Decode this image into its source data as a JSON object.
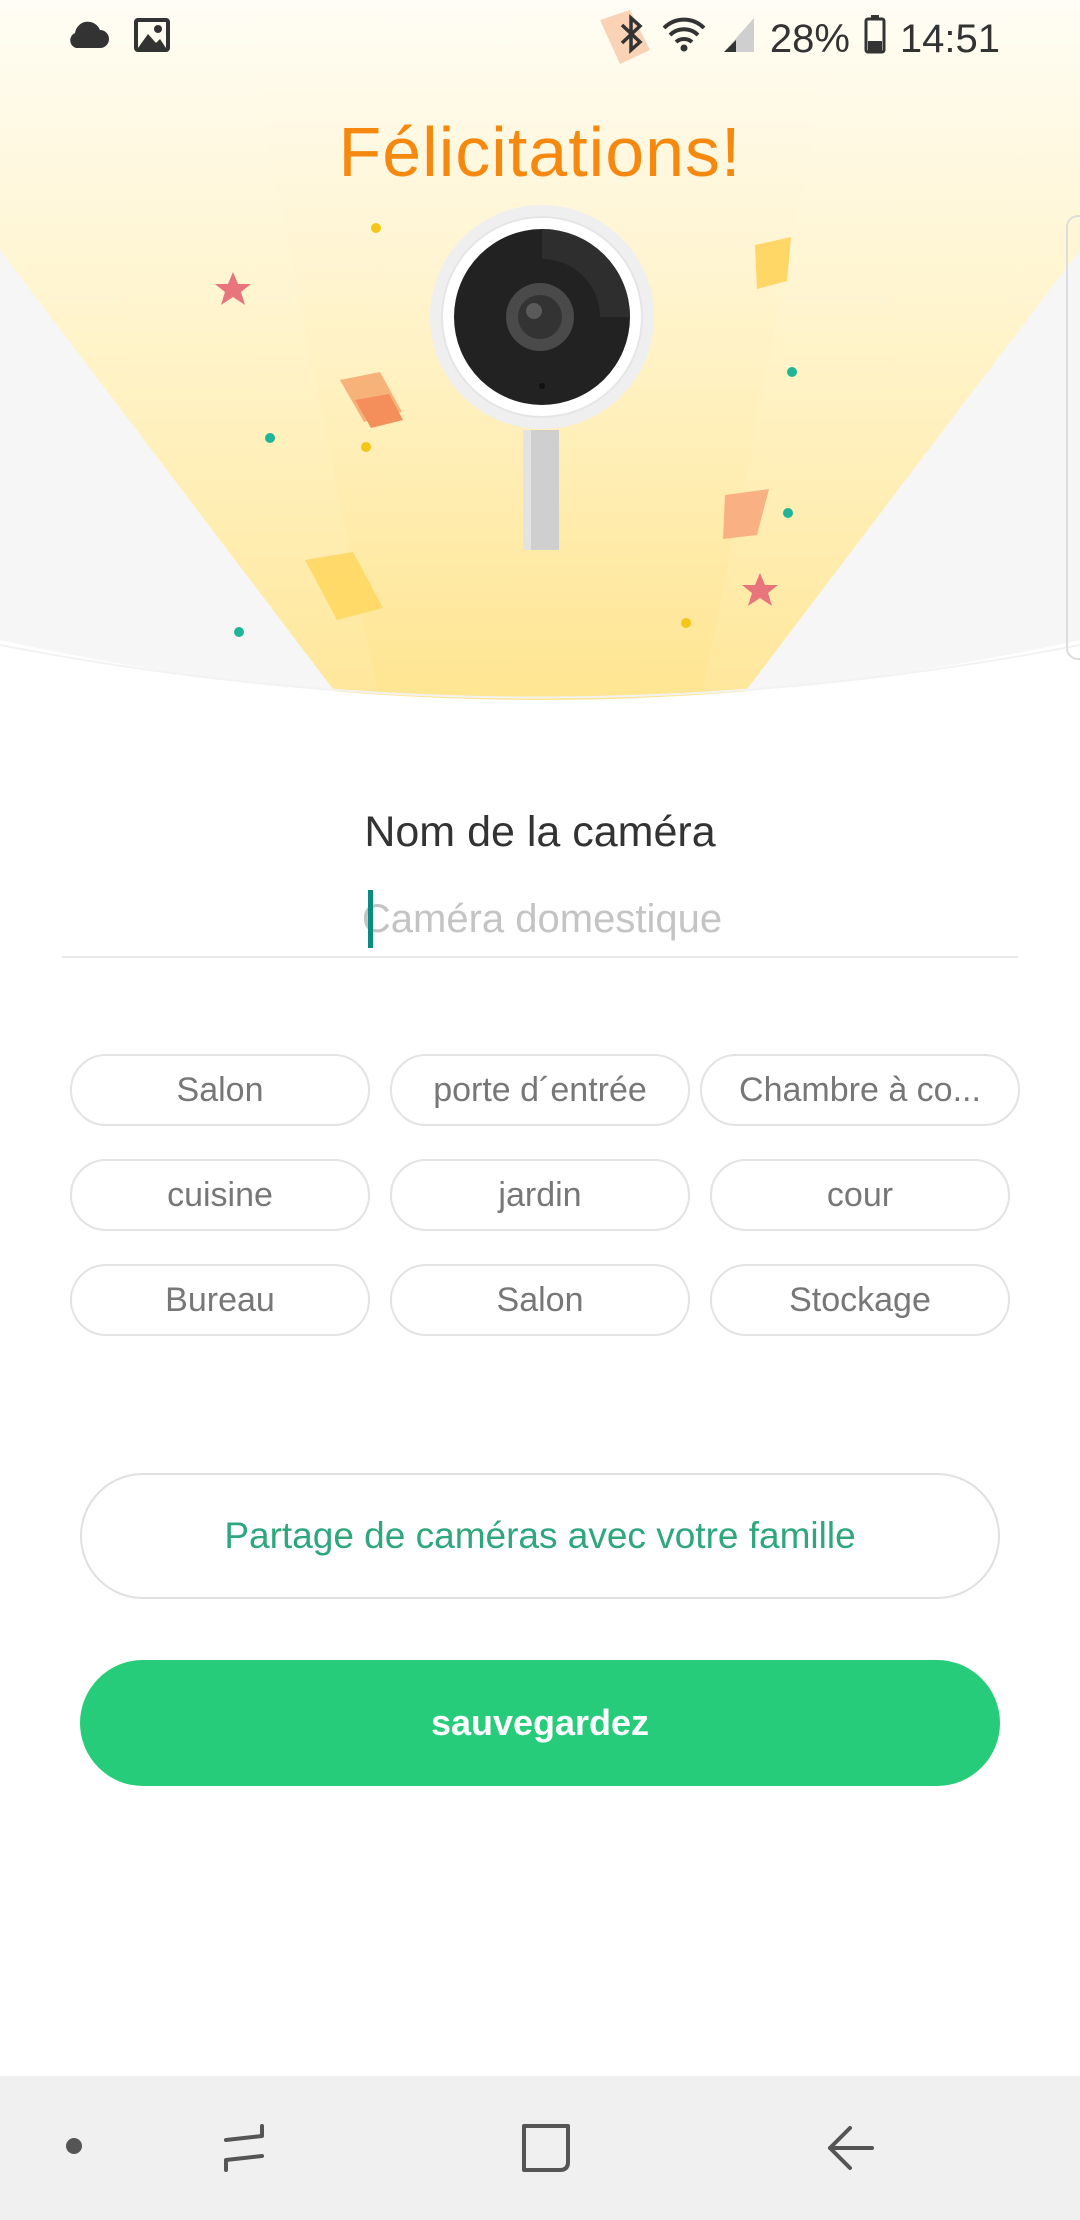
{
  "status_bar": {
    "battery": "28%",
    "time": "14:51"
  },
  "hero": {
    "title": "Félicitations!"
  },
  "name_section": {
    "label": "Nom de la caméra",
    "input_value": "",
    "placeholder": "Caméra domestique"
  },
  "chips": [
    "Salon",
    "porte d´entrée",
    "Chambre à co...",
    "cuisine",
    "jardin",
    "cour",
    "Bureau",
    "Salon",
    "Stockage"
  ],
  "actions": {
    "share_label": "Partage de caméras avec votre famille",
    "save_label": "sauvegardez"
  },
  "colors": {
    "title_orange": "#f5890f",
    "accent_green": "#27cc7a",
    "share_text_green": "#2fa77c"
  },
  "icons": {
    "status_left": [
      "cloud-icon",
      "image-icon"
    ],
    "status_right": [
      "bluetooth-icon",
      "wifi-icon",
      "signal-icon",
      "battery-icon"
    ],
    "nav": [
      "dot-icon",
      "recent-apps-icon",
      "home-icon",
      "back-icon"
    ]
  }
}
